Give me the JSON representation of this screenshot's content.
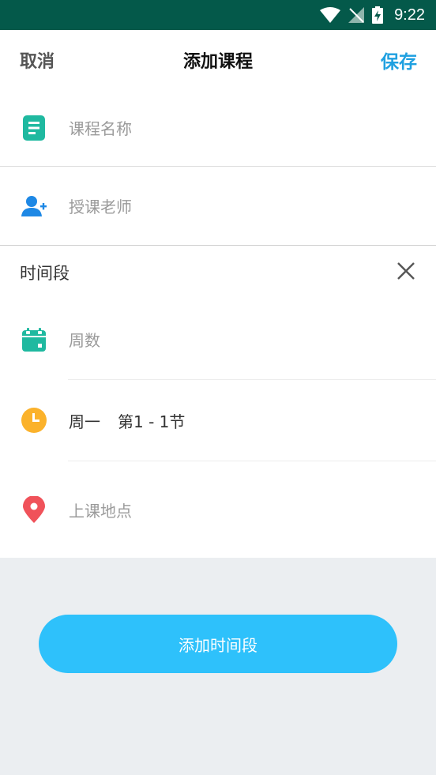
{
  "status_bar": {
    "time": "9:22"
  },
  "header": {
    "cancel": "取消",
    "title": "添加课程",
    "save": "保存"
  },
  "course_fields": {
    "name_placeholder": "课程名称",
    "teacher_placeholder": "授课老师"
  },
  "time_slot": {
    "title": "时间段",
    "weeks_placeholder": "周数",
    "day_value": "周一",
    "period_value": "第1 - 1节",
    "location_placeholder": "上课地点"
  },
  "actions": {
    "add_time_slot": "添加时间段"
  },
  "colors": {
    "status_bar": "#04594a",
    "accent": "#1fa0e0",
    "button": "#2ec1fb",
    "teal_icon": "#1fb9a0",
    "person_icon": "#1e88e5",
    "clock_icon": "#fbb22b",
    "pin_icon": "#f0525a",
    "bottom_bg": "#ebeef1"
  }
}
